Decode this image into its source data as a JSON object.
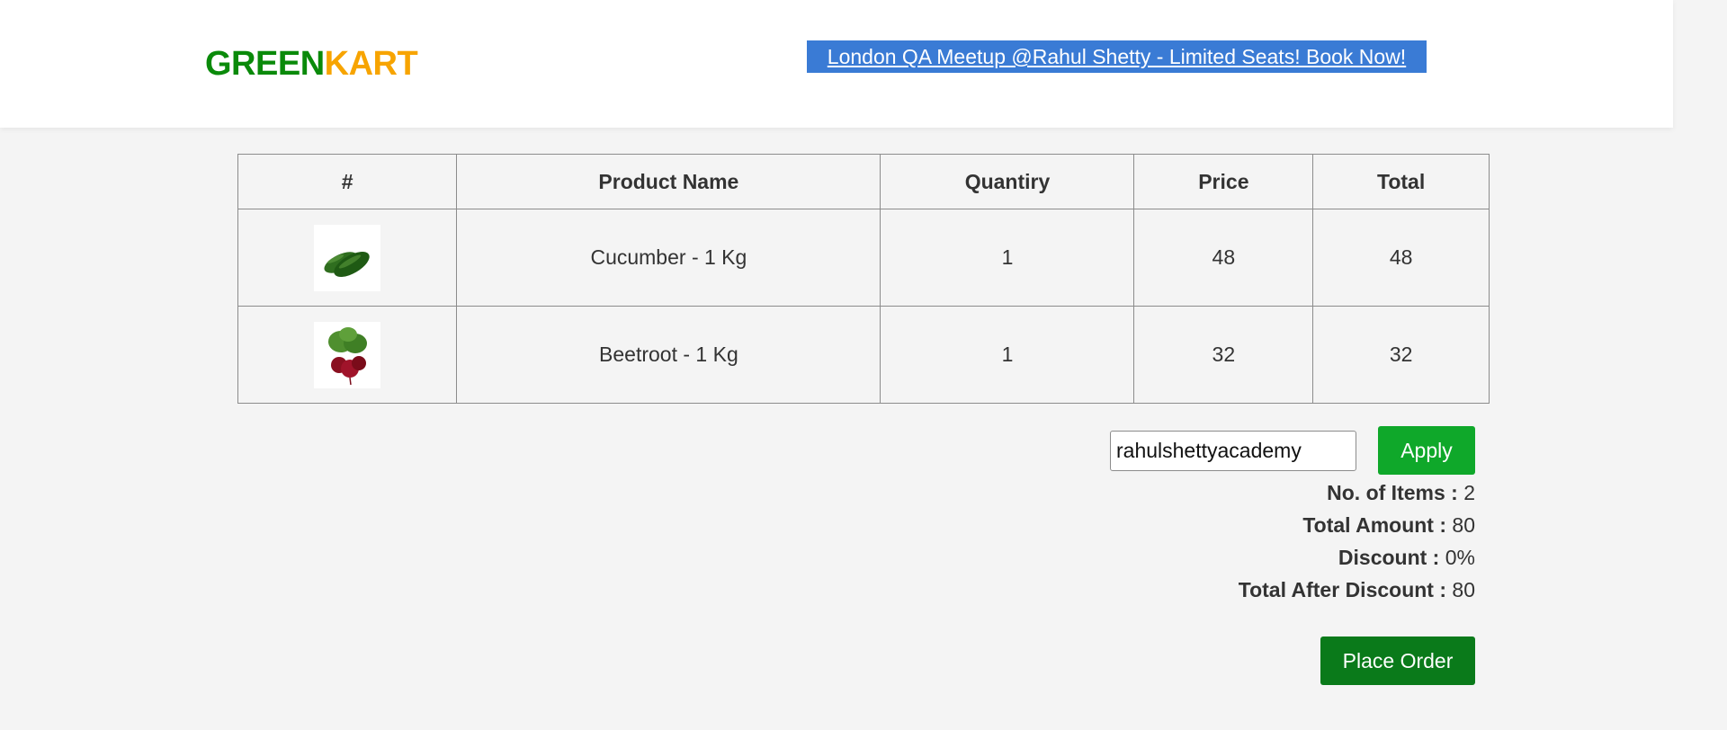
{
  "header": {
    "brand_part1": "GREEN",
    "brand_part2": "KART",
    "promo_link": "London QA Meetup @Rahul Shetty - Limited Seats! Book Now!"
  },
  "cart": {
    "columns": [
      "#",
      "Product Name",
      "Quantiry",
      "Price",
      "Total"
    ],
    "rows": [
      {
        "image_icon": "cucumber-image",
        "name": "Cucumber - 1 Kg",
        "quantity": "1",
        "price": "48",
        "total": "48"
      },
      {
        "image_icon": "beetroot-image",
        "name": "Beetroot - 1 Kg",
        "quantity": "1",
        "price": "32",
        "total": "32"
      }
    ]
  },
  "promo": {
    "code_value": "rahulshettyacademy",
    "apply_label": "Apply"
  },
  "summary": {
    "items_label": "No. of Items :",
    "items_value": "2",
    "amount_label": "Total Amount :",
    "amount_value": "80",
    "discount_label": "Discount :",
    "discount_value": "0%",
    "after_label": "Total After Discount :",
    "after_value": "80"
  },
  "place_order_label": "Place Order",
  "colors": {
    "brand_green": "#0a8a0a",
    "brand_orange": "#f7a400",
    "promo_blue": "#3a7bd5",
    "apply_green": "#0fa82a",
    "place_order_green": "#0a7a1a"
  }
}
